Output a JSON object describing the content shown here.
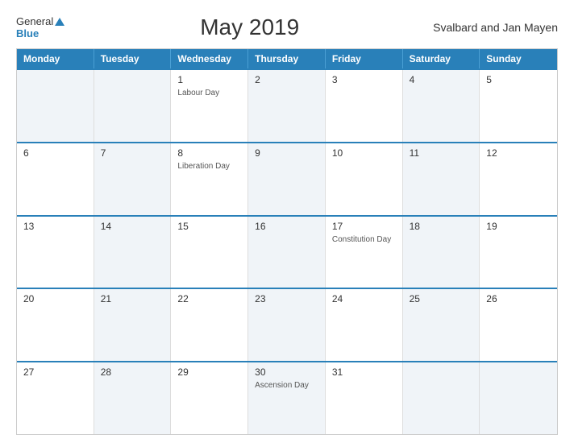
{
  "header": {
    "title": "May 2019",
    "region": "Svalbard and Jan Mayen",
    "logo_general": "General",
    "logo_blue": "Blue"
  },
  "columns": [
    "Monday",
    "Tuesday",
    "Wednesday",
    "Thursday",
    "Friday",
    "Saturday",
    "Sunday"
  ],
  "weeks": [
    [
      {
        "day": "",
        "holiday": "",
        "empty": true
      },
      {
        "day": "",
        "holiday": "",
        "empty": true
      },
      {
        "day": "1",
        "holiday": "Labour Day",
        "empty": false
      },
      {
        "day": "2",
        "holiday": "",
        "empty": false
      },
      {
        "day": "3",
        "holiday": "",
        "empty": false
      },
      {
        "day": "4",
        "holiday": "",
        "empty": false
      },
      {
        "day": "5",
        "holiday": "",
        "empty": false
      }
    ],
    [
      {
        "day": "6",
        "holiday": "",
        "empty": false
      },
      {
        "day": "7",
        "holiday": "",
        "empty": false
      },
      {
        "day": "8",
        "holiday": "Liberation Day",
        "empty": false
      },
      {
        "day": "9",
        "holiday": "",
        "empty": false
      },
      {
        "day": "10",
        "holiday": "",
        "empty": false
      },
      {
        "day": "11",
        "holiday": "",
        "empty": false
      },
      {
        "day": "12",
        "holiday": "",
        "empty": false
      }
    ],
    [
      {
        "day": "13",
        "holiday": "",
        "empty": false
      },
      {
        "day": "14",
        "holiday": "",
        "empty": false
      },
      {
        "day": "15",
        "holiday": "",
        "empty": false
      },
      {
        "day": "16",
        "holiday": "",
        "empty": false
      },
      {
        "day": "17",
        "holiday": "Constitution Day",
        "empty": false
      },
      {
        "day": "18",
        "holiday": "",
        "empty": false
      },
      {
        "day": "19",
        "holiday": "",
        "empty": false
      }
    ],
    [
      {
        "day": "20",
        "holiday": "",
        "empty": false
      },
      {
        "day": "21",
        "holiday": "",
        "empty": false
      },
      {
        "day": "22",
        "holiday": "",
        "empty": false
      },
      {
        "day": "23",
        "holiday": "",
        "empty": false
      },
      {
        "day": "24",
        "holiday": "",
        "empty": false
      },
      {
        "day": "25",
        "holiday": "",
        "empty": false
      },
      {
        "day": "26",
        "holiday": "",
        "empty": false
      }
    ],
    [
      {
        "day": "27",
        "holiday": "",
        "empty": false
      },
      {
        "day": "28",
        "holiday": "",
        "empty": false
      },
      {
        "day": "29",
        "holiday": "",
        "empty": false
      },
      {
        "day": "30",
        "holiday": "Ascension Day",
        "empty": false
      },
      {
        "day": "31",
        "holiday": "",
        "empty": false
      },
      {
        "day": "",
        "holiday": "",
        "empty": true
      },
      {
        "day": "",
        "holiday": "",
        "empty": true
      }
    ]
  ]
}
